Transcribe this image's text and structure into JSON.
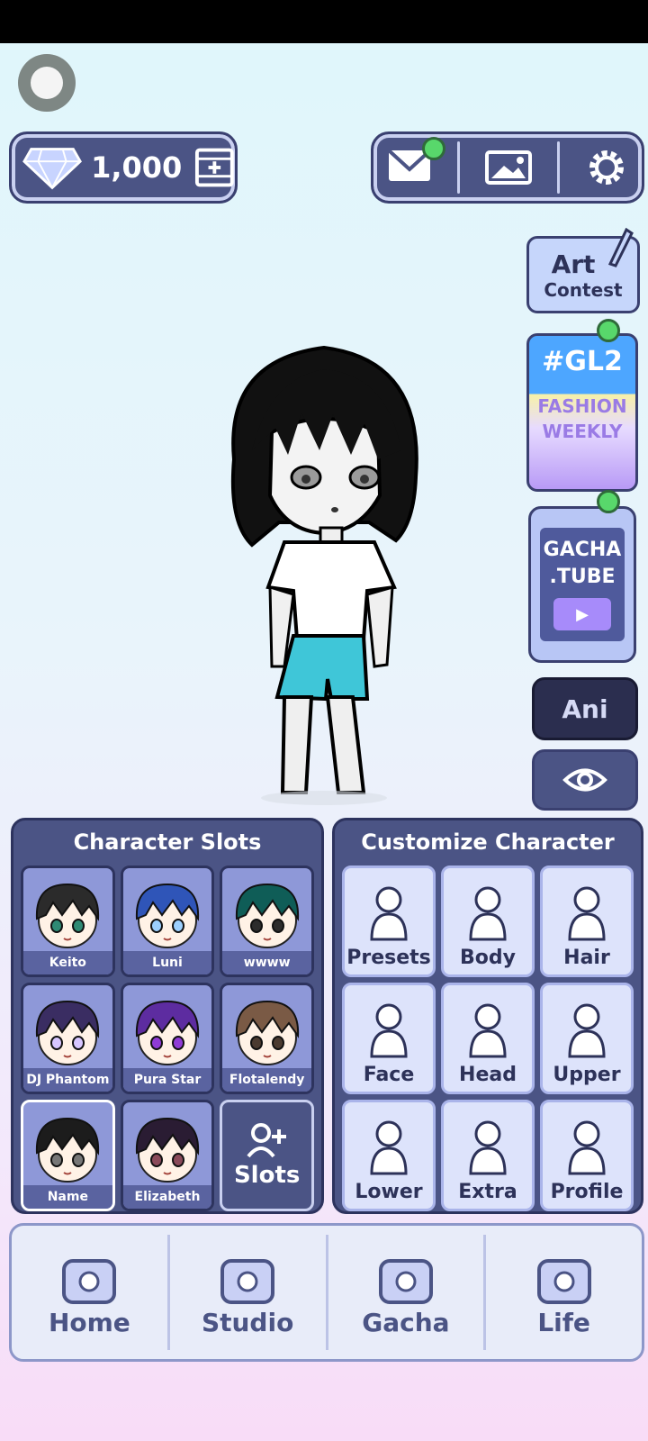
{
  "currency": {
    "diamonds": "1,000"
  },
  "side": {
    "art_contest": {
      "line1": "Art",
      "line2": "Contest"
    },
    "gl2": {
      "tag": "#GL2",
      "line1": "FASHION",
      "line2": "WEEKLY"
    },
    "gacha_tube": {
      "line1": "GACHA",
      "line2": ".TUBE"
    },
    "ani_label": "Ani"
  },
  "character_slots": {
    "title": "Character Slots",
    "slots": [
      {
        "name": "Keito",
        "hair": "#2b2b2b",
        "eyes": "#2f8a74"
      },
      {
        "name": "Luni",
        "hair": "#2f55b8",
        "eyes": "#9cd0ff"
      },
      {
        "name": "wwww",
        "hair": "#0f5d57",
        "eyes": "#2c2c2c"
      },
      {
        "name": "DJ Phantom",
        "hair": "#3a2d62",
        "eyes": "#d7c6ff"
      },
      {
        "name": "Pura Star",
        "hair": "#5d2ca0",
        "eyes": "#8f3bd6"
      },
      {
        "name": "Flotalendy",
        "hair": "#7a5a45",
        "eyes": "#4a3a30"
      },
      {
        "name": "Name",
        "hair": "#1c1c1c",
        "eyes": "#777777"
      },
      {
        "name": "Elizabeth",
        "hair": "#2a1c33",
        "eyes": "#8a4a5a"
      }
    ],
    "add_label": "Slots"
  },
  "customize": {
    "title": "Customize Character",
    "items": [
      {
        "label": "Presets",
        "icon": "presets-icon"
      },
      {
        "label": "Body",
        "icon": "body-icon"
      },
      {
        "label": "Hair",
        "icon": "hair-icon"
      },
      {
        "label": "Face",
        "icon": "face-icon"
      },
      {
        "label": "Head",
        "icon": "head-icon"
      },
      {
        "label": "Upper",
        "icon": "upper-icon"
      },
      {
        "label": "Lower",
        "icon": "lower-icon"
      },
      {
        "label": "Extra",
        "icon": "extra-icon"
      },
      {
        "label": "Profile",
        "icon": "profile-icon"
      }
    ]
  },
  "bottom_nav": {
    "items": [
      {
        "label": "Home",
        "icon": "house-icon"
      },
      {
        "label": "Studio",
        "icon": "clapperboard-icon"
      },
      {
        "label": "Gacha",
        "icon": "gacha-orb-icon"
      },
      {
        "label": "Life",
        "icon": "flower-icon"
      }
    ]
  },
  "colors": {
    "panel": "#4b5485",
    "accent_dot": "#58d86b"
  }
}
